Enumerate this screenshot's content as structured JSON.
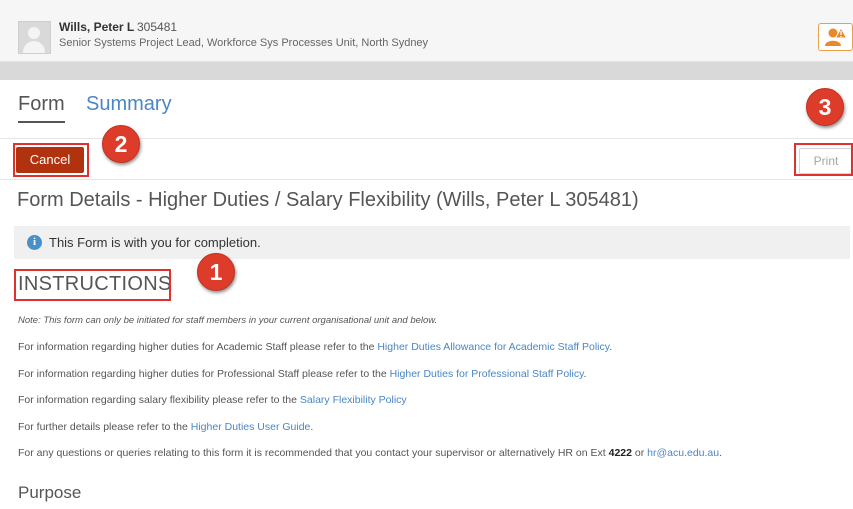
{
  "header": {
    "user_name": "Wills, Peter L",
    "user_id": "305481",
    "user_role": "Senior Systems Project Lead, Workforce Sys Processes Unit, North Sydney"
  },
  "tabs": [
    {
      "label": "Form"
    },
    {
      "label": "Summary"
    }
  ],
  "actions": {
    "cancel_label": "Cancel",
    "print_label": "Print"
  },
  "form": {
    "title": "Form Details - Higher Duties / Salary Flexibility (Wills, Peter L 305481)",
    "info_message": "This Form is with you for completion.",
    "instructions_heading": "INSTRUCTIONS",
    "note": "Note: This form can only be initiated for staff members in your current organisational unit and below.",
    "lines": [
      {
        "prefix": "For information regarding higher duties for Academic Staff please refer to the ",
        "link": "Higher Duties Allowance for Academic Staff Policy",
        "suffix": "."
      },
      {
        "prefix": "For information regarding higher duties for Professional Staff please refer to the ",
        "link": "Higher Duties for Professional Staff Policy",
        "suffix": "."
      },
      {
        "prefix": "For information regarding salary flexibility please refer to the ",
        "link": "Salary Flexibility Policy",
        "suffix": ""
      },
      {
        "prefix": "For further details please refer to the ",
        "link": "Higher Duties User Guide",
        "suffix": "."
      }
    ],
    "contact": {
      "prefix": "For any questions or queries relating to this form it is recommended that you contact your supervisor or alternatively HR on Ext ",
      "ext": "4222",
      "middle": " or ",
      "email": "hr@acu.edu.au",
      "suffix": "."
    },
    "purpose_heading": "Purpose"
  },
  "annotations": {
    "badge_1": "1",
    "badge_2": "2",
    "badge_3": "3"
  },
  "colors": {
    "cancel_button": "#b1320e",
    "link": "#4a86c5",
    "annotation_red": "#dd3c2b"
  }
}
